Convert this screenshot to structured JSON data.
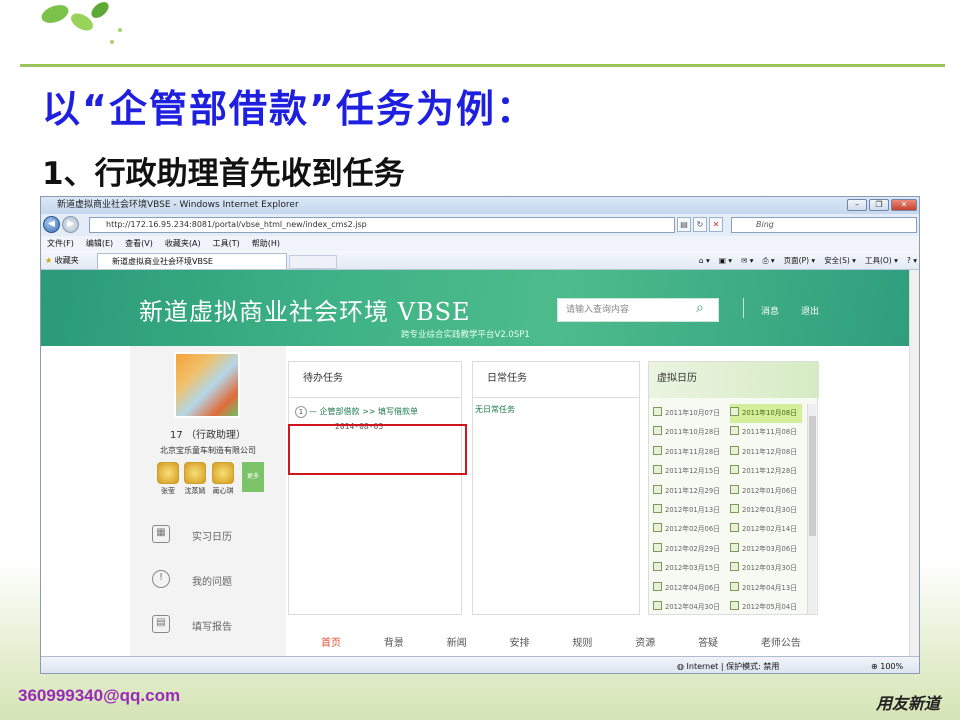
{
  "slide": {
    "title": "以“企管部借款”任务为例：",
    "subtitle": "1、行政助理首先收到任务",
    "footer_email": "360999340@qq.com",
    "footer_logo": "用友新道"
  },
  "browser": {
    "window_title": "新道虚拟商业社会环境VBSE - Windows Internet Explorer",
    "url": "http://172.16.95.234:8081/portal/vbse_html_new/index_cms2.jsp",
    "search_placeholder": "Bing",
    "menu": [
      "文件(F)",
      "编辑(E)",
      "查看(V)",
      "收藏夹(A)",
      "工具(T)",
      "帮助(H)"
    ],
    "favorites_label": "收藏夹",
    "tab_title": "新道虚拟商业社会环境VBSE",
    "commands": [
      "页面(P) ▾",
      "安全(S) ▾",
      "工具(O) ▾"
    ],
    "status_zone": "Internet | 保护模式: 禁用",
    "zoom": "100%"
  },
  "site": {
    "brand": "新道虚拟商业社会环境 VBSE",
    "brand_sub": "跨专业综合实践教学平台V2.0SP1",
    "search_placeholder": "请输入查询内容",
    "links": [
      "消息",
      "退出"
    ],
    "user": {
      "name": "17 （行政助理）",
      "company": "北京宝乐童车制造有限公司",
      "friends": [
        "张莹",
        "沈蒸嫣",
        "蔺心琪"
      ],
      "add_label": "更多"
    },
    "side_menu": [
      {
        "icon": "calendar-icon",
        "glyph": "▦",
        "label": "实习日历"
      },
      {
        "icon": "question-icon",
        "glyph": "!",
        "label": "我的问题"
      },
      {
        "icon": "report-icon",
        "glyph": "▤",
        "label": "填写报告"
      }
    ],
    "panels": {
      "todo": {
        "title": "待办任务",
        "item_num": "1",
        "item_text": "— 企管部借款 >> 填写借款单",
        "item_date": "2014-08-03"
      },
      "daily": {
        "title": "日常任务",
        "empty_text": "无日常任务"
      },
      "calendar": {
        "title": "虚拟日历",
        "left": [
          "2011年10月07日",
          "2011年10月28日",
          "2011年11月28日",
          "2011年12月15日",
          "2011年12月29日",
          "2012年01月13日",
          "2012年02月06日",
          "2012年02月29日",
          "2012年03月15日",
          "2012年04月06日",
          "2012年04月30日"
        ],
        "right": [
          "2011年10月08日",
          "2011年11月08日",
          "2011年12月08日",
          "2011年12月28日",
          "2012年01月06日",
          "2012年01月30日",
          "2012年02月14日",
          "2012年03月06日",
          "2012年03月30日",
          "2012年04月13日",
          "2012年05月04日"
        ],
        "selected": "2011年10月08日"
      }
    },
    "bottom_nav": [
      "首页",
      "背景",
      "新闻",
      "安排",
      "规则",
      "资源",
      "答疑",
      "老师公告"
    ]
  }
}
